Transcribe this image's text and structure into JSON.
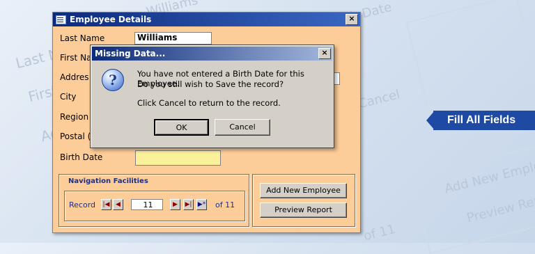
{
  "background": {
    "ghost_fields": [
      "Last Name",
      "First Name",
      "Address",
      "City"
    ],
    "ghost_buttons": [
      "Add New Employee",
      "Preview Report"
    ],
    "ghost_misc": [
      "Cancel",
      "Williams",
      "Birth Date",
      "of 11"
    ]
  },
  "badge": {
    "label": "Fill All Fields",
    "color": "#1f4aa3"
  },
  "employee_window": {
    "title": "Employee Details",
    "close": "×",
    "fields": {
      "last_name": {
        "label": "Last Name",
        "value": "Williams"
      },
      "first_name": {
        "label": "First Na",
        "value": ""
      },
      "address": {
        "label": "Addres",
        "value": ""
      },
      "city": {
        "label": "City",
        "value": ""
      },
      "region": {
        "label": "Region",
        "value": ""
      },
      "postal": {
        "label": "Postal (",
        "value": ""
      },
      "birth_date": {
        "label": "Birth Date",
        "value": ""
      }
    },
    "navigation": {
      "group_label": "Navigation Facilities",
      "record_label": "Record",
      "current": "11",
      "of_label": "of 11",
      "first_icon": "|◀",
      "prev_icon": "◀",
      "next_icon": "▶",
      "last_icon": "▶|",
      "new_icon": "▶*"
    },
    "buttons": {
      "add_new": "Add New Employee",
      "preview": "Preview Report"
    },
    "colors": {
      "background": "#fdcd99",
      "birth_date_field": "#fbf19a"
    }
  },
  "dialog": {
    "title": "Missing Data...",
    "close": "×",
    "icon": "question-icon",
    "icon_glyph": "?",
    "line1": "You have not entered a Birth Date for this Employee.",
    "line2": "Do you still wish to Save the record?",
    "line3": "Click Cancel to return to the record.",
    "ok": "OK",
    "cancel": "Cancel"
  }
}
